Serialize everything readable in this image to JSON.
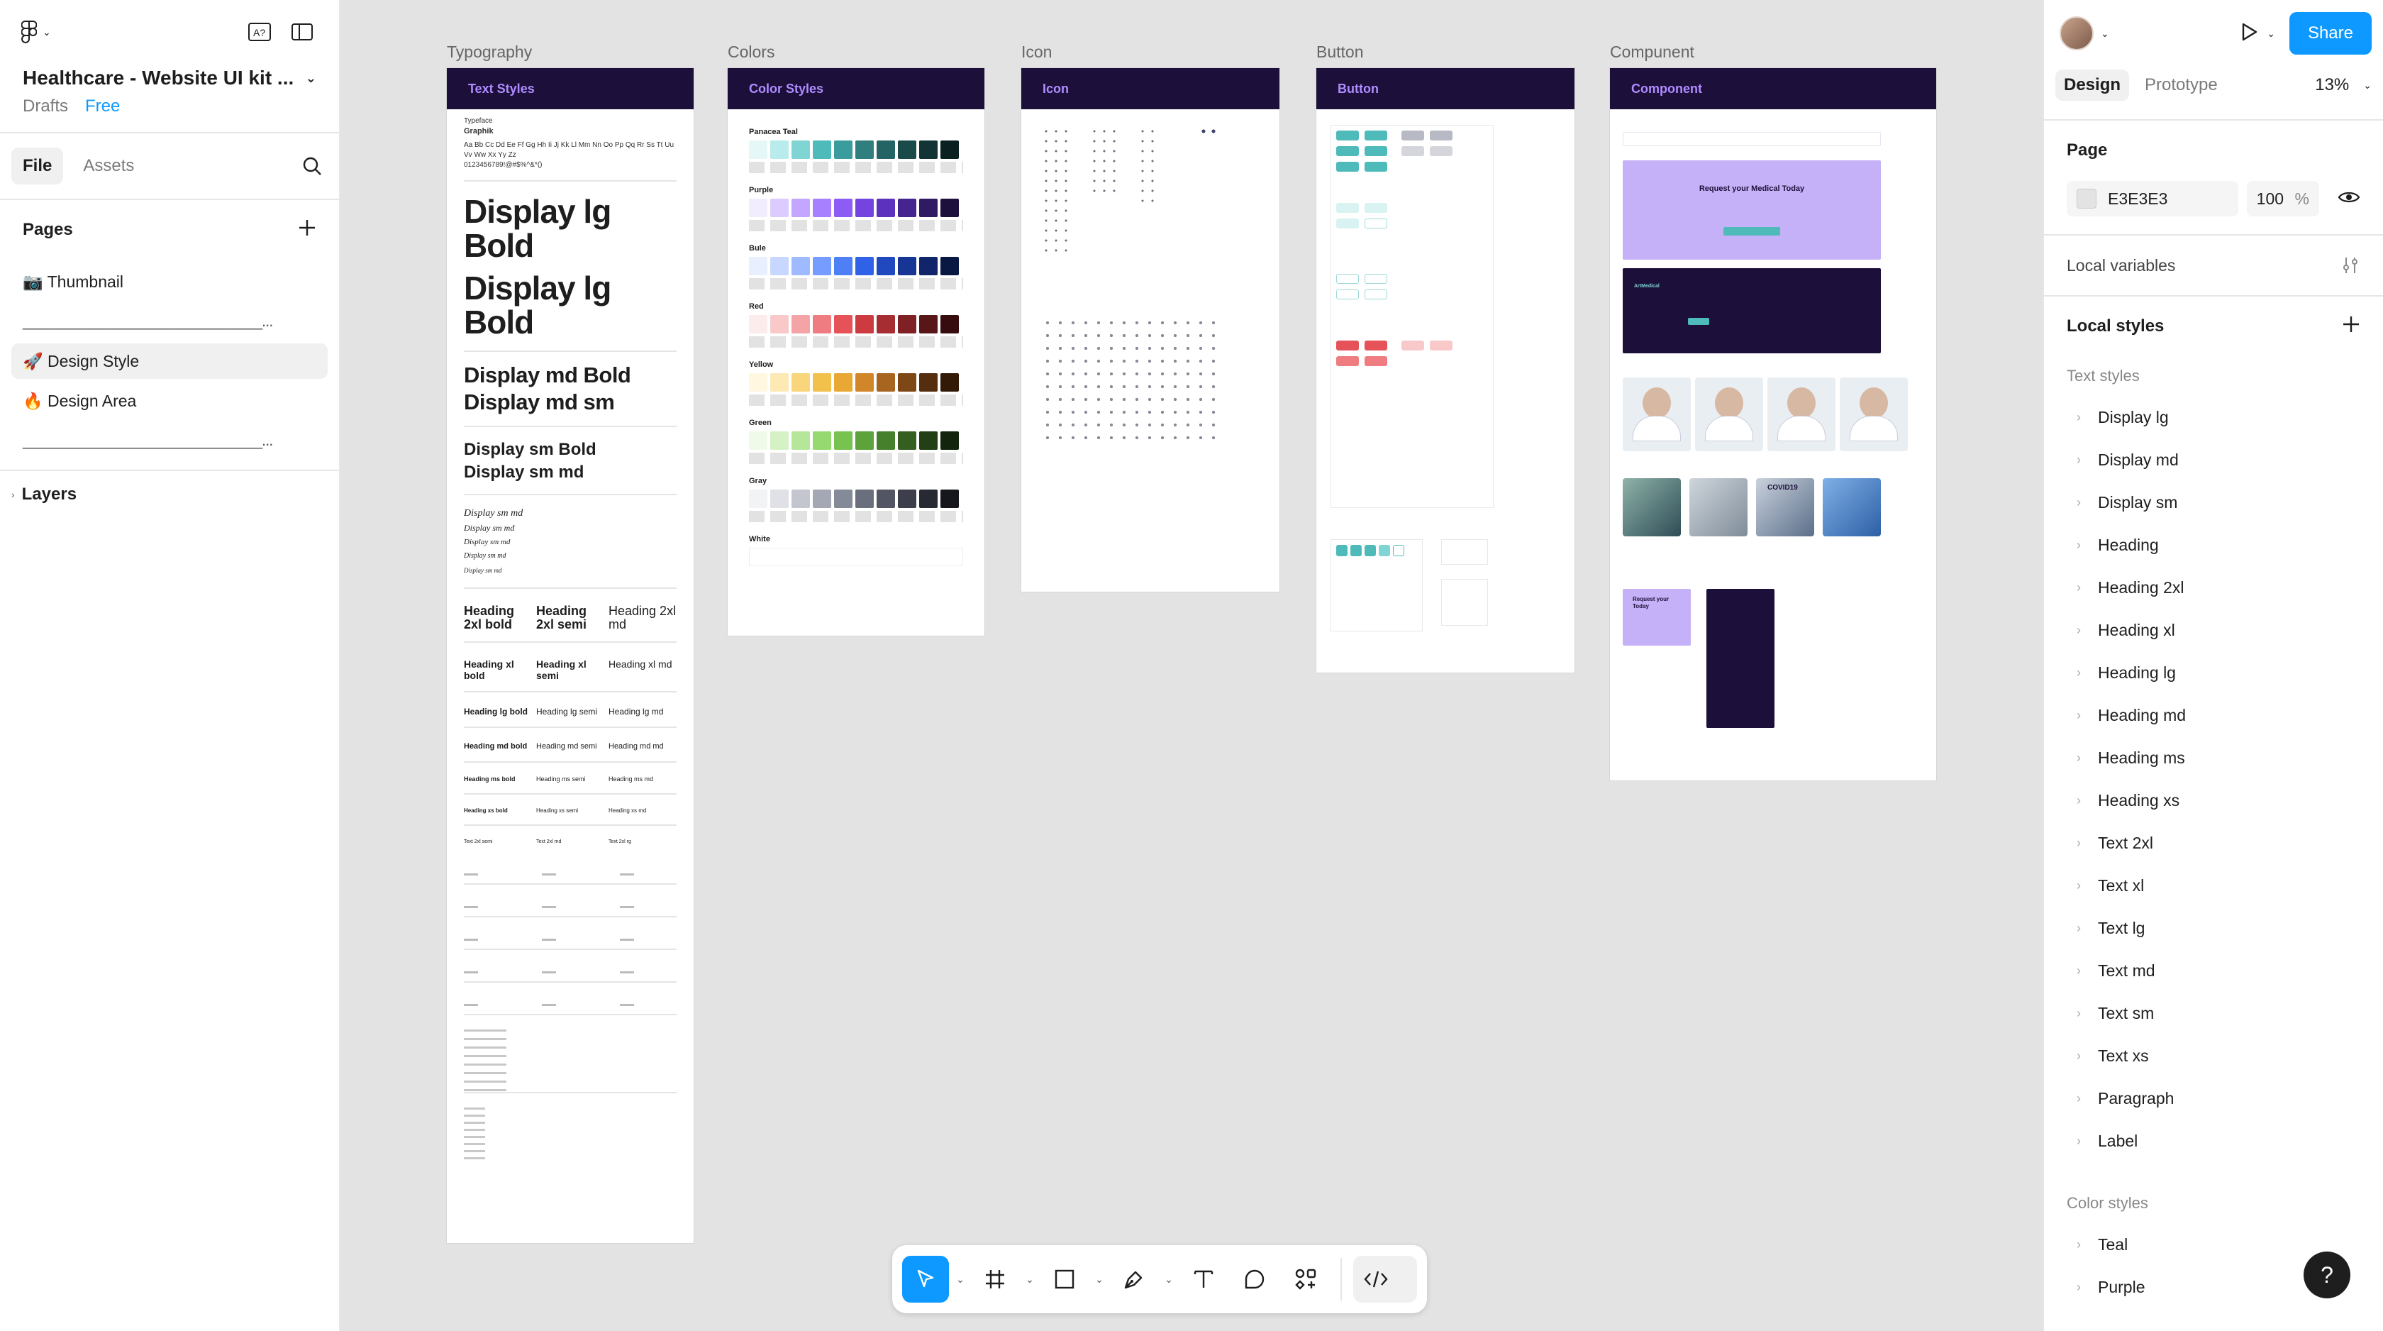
{
  "file": {
    "title": "Healthcare - Website UI kit ...",
    "location": "Drafts",
    "plan": "Free"
  },
  "left_tabs": {
    "file": "File",
    "assets": "Assets"
  },
  "pages": {
    "heading": "Pages",
    "items": [
      {
        "label": "📷 Thumbnail"
      },
      {
        "label": "______________________________..."
      },
      {
        "label": "🚀 Design Style"
      },
      {
        "label": "🔥 Design Area"
      },
      {
        "label": "______________________________..."
      }
    ]
  },
  "layers": {
    "heading": "Layers"
  },
  "right_tabs": {
    "design": "Design",
    "prototype": "Prototype",
    "zoom": "13%"
  },
  "share_label": "Share",
  "page_section": {
    "heading": "Page",
    "color": "E3E3E3",
    "opacity": "100",
    "percent": "%"
  },
  "local_variables": "Local variables",
  "local_styles": "Local styles",
  "text_styles": {
    "heading": "Text styles",
    "items": [
      "Display lg",
      "Display md",
      "Display sm",
      "Heading",
      "Heading 2xl",
      "Heading xl",
      "Heading lg",
      "Heading md",
      "Heading ms",
      "Heading xs",
      "Text 2xl",
      "Text xl",
      "Text lg",
      "Text md",
      "Text sm",
      "Text xs",
      "Paragraph",
      "Label"
    ]
  },
  "color_styles": {
    "heading": "Color styles",
    "items": [
      "Teal",
      "Purple"
    ]
  },
  "help_label": "?",
  "canvas": {
    "frames": [
      {
        "label": "Typography",
        "header": "Text Styles"
      },
      {
        "label": "Colors",
        "header": "Color Styles"
      },
      {
        "label": "Icon",
        "header": "Icon"
      },
      {
        "label": "Button",
        "header": "Button"
      },
      {
        "label": "Compunent",
        "header": "Component"
      }
    ],
    "typography": {
      "family_label": "Typeface",
      "family": "Graphik",
      "alphabet": "Aa Bb Cc Dd Ee Ff Gg Hh Ii Jj Kk Ll Mm Nn Oo Pp Qq Rr Ss Tt Uu Vv Ww Xx Yy Zz",
      "digits": "0123456789!@#$%^&*()",
      "display_lg_1": "Display lg Bold",
      "display_lg_2": "Display lg Bold",
      "display_md_bold": "Display md Bold",
      "display_md_sm": "Display md sm",
      "display_sm_bold": "Display sm Bold",
      "display_sm_md": "Display sm md",
      "italic_1": "Display sm md",
      "italic_2": "Display sm md",
      "italic_3": "Display sm md",
      "italic_4": "Display sm md",
      "italic_5": "Display sm md",
      "heading_2xl": [
        "Heading 2xl bold",
        "Heading 2xl semi",
        "Heading 2xl md"
      ],
      "heading_xl": [
        "Heading xl bold",
        "Heading xl semi",
        "Heading xl md"
      ],
      "heading_lg": [
        "Heading lg bold",
        "Heading lg semi",
        "Heading lg md"
      ],
      "heading_md": [
        "Heading md bold",
        "Heading md semi",
        "Heading md md"
      ],
      "heading_ms": [
        "Heading ms bold",
        "Heading ms semi",
        "Heading ms md"
      ],
      "heading_xs": [
        "Heading xs bold",
        "Heading xs semi",
        "Heading xs md"
      ],
      "text_2xl": [
        "Text 2xl semi",
        "Text 2xl md",
        "Text 2xl rg"
      ]
    },
    "colors": {
      "groups": [
        {
          "name": "Panacea Teal",
          "swatches": [
            "#e6f7f7",
            "#b8ebeb",
            "#7fd4d4",
            "#4fbaba",
            "#3a9c9c",
            "#2f7f7f",
            "#256464",
            "#1b4a4a",
            "#123434",
            "#0b2020"
          ]
        },
        {
          "name": "Purple",
          "swatches": [
            "#f2ecff",
            "#dccbff",
            "#c2a6ff",
            "#a680ff",
            "#8c5cf5",
            "#7443e0",
            "#5c31bd",
            "#45248f",
            "#301a63",
            "#1e103d"
          ]
        },
        {
          "name": "Bule",
          "swatches": [
            "#e8efff",
            "#c7d7ff",
            "#9fbaff",
            "#779cff",
            "#4f7ff5",
            "#2f62e6",
            "#2048bf",
            "#173594",
            "#10256a",
            "#091743"
          ]
        },
        {
          "name": "Red",
          "swatches": [
            "#fdecec",
            "#f9c9ca",
            "#f4a3a6",
            "#ee7c80",
            "#e55358",
            "#cc3b40",
            "#a62d31",
            "#7f2124",
            "#591618",
            "#370c0e"
          ]
        },
        {
          "name": "Yellow",
          "swatches": [
            "#fff7e0",
            "#fde9b3",
            "#f9d57c",
            "#f2c14c",
            "#e9a833",
            "#d1862a",
            "#a8651f",
            "#7d4716",
            "#542e0e",
            "#321a07"
          ]
        },
        {
          "name": "Green",
          "swatches": [
            "#effbe8",
            "#d5f2c5",
            "#b5e79a",
            "#95d970",
            "#78c24f",
            "#5ea23b",
            "#47802d",
            "#345f21",
            "#223f16",
            "#13250c"
          ]
        },
        {
          "name": "Gray",
          "swatches": [
            "#f2f3f5",
            "#dfe1e6",
            "#c3c6cf",
            "#a4a8b4",
            "#858a98",
            "#6a6f7d",
            "#525664",
            "#3c3f4b",
            "#282a33",
            "#16171d"
          ]
        }
      ],
      "white_label": "White"
    },
    "component": {
      "hero_title": "Request your Medical Today",
      "brand": "ArtMedical",
      "covid_label": "COVID19",
      "cta_title": "Request your Today"
    }
  },
  "accent": "#0d99ff",
  "frame_header_bg": "#1c0f3a",
  "frame_header_text": "#b08cff"
}
